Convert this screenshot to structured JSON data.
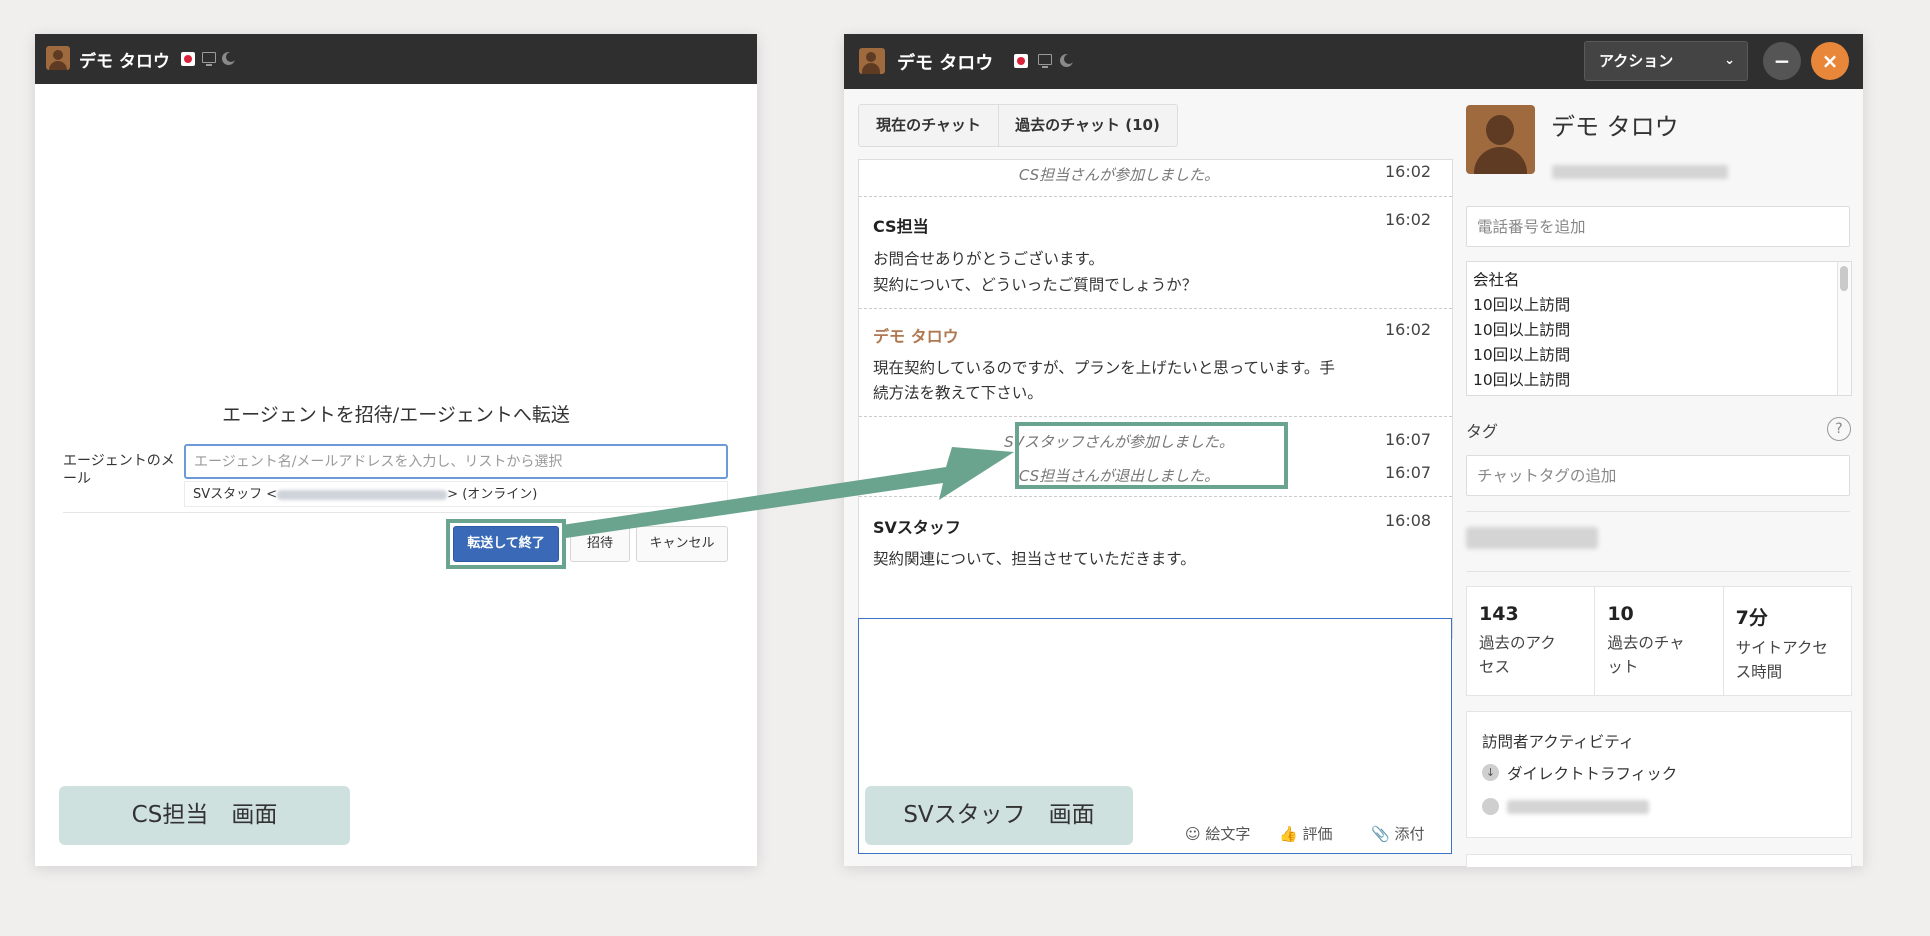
{
  "user_name": "デモ タロウ",
  "left_window": {
    "invite_title": "エージェントを招待/エージェントへ転送",
    "email_label": "エージェントのメール",
    "email_placeholder": "エージェント名/メールアドレスを入力し、リストから選択",
    "suggestion_prefix": "SVスタッフ <",
    "suggestion_suffix": "> (オンライン)",
    "buttons": {
      "transfer": "転送して終了",
      "invite": "招待",
      "cancel": "キャンセル"
    },
    "screen_label": "CS担当　画面"
  },
  "right_window": {
    "action_label": "アクション",
    "minimize_glyph": "−",
    "close_glyph": "×",
    "tabs": [
      "現在のチャット",
      "過去のチャット (10)"
    ],
    "chat": {
      "system_joined_cs": "CS担当さんが参加しました。",
      "system_joined_cs_time": "16:02",
      "cs_sender": "CS担当",
      "cs_time": "16:02",
      "cs_line1": "お問合せありがとうございます。",
      "cs_line2": "契約について、どういったご質問でしょうか？",
      "visitor_sender": "デモ タロウ",
      "visitor_time": "16:02",
      "visitor_line1": "現在契約しているのですが、プランを上げたいと思っています。手",
      "visitor_line2": "続方法を教えて下さい。",
      "system_joined_sv": "SVスタッフさんが参加しました。",
      "system_joined_sv_time": "16:07",
      "system_left_cs": "CS担当さんが退出しました。",
      "system_left_cs_time": "16:07",
      "sv_sender": "SVスタッフ",
      "sv_time": "16:08",
      "sv_line1": "契約関連について、担当させていただきます。"
    },
    "composer_tools": {
      "emoji": "絵文字",
      "rate": "評価",
      "attach": "添付"
    },
    "screen_label": "SVスタッフ　画面",
    "sidebar": {
      "name": "デモ タロウ",
      "phone_placeholder": "電話番号を追加",
      "custom_fields": [
        "会社名",
        "10回以上訪問",
        "10回以上訪問",
        "10回以上訪問",
        "10回以上訪問"
      ],
      "tags_label": "タグ",
      "help_glyph": "?",
      "tag_placeholder": "チャットタグの追加",
      "stats": [
        {
          "value": "143",
          "label": "過去のアク\nセス"
        },
        {
          "value": "10",
          "label": "過去のチャ\nット"
        },
        {
          "value": "7分",
          "label": "サイトアクセ\nス時間"
        }
      ],
      "activity_title": "訪問者アクティビティ",
      "activity_item": "ダイレクトトラフィック"
    }
  },
  "colors": {
    "titlebar": "#2f2f2f",
    "primary_button": "#3a6ab7",
    "highlight": "#6aa48f",
    "close_button": "#e8873a",
    "label_box": "#cfe1df"
  }
}
